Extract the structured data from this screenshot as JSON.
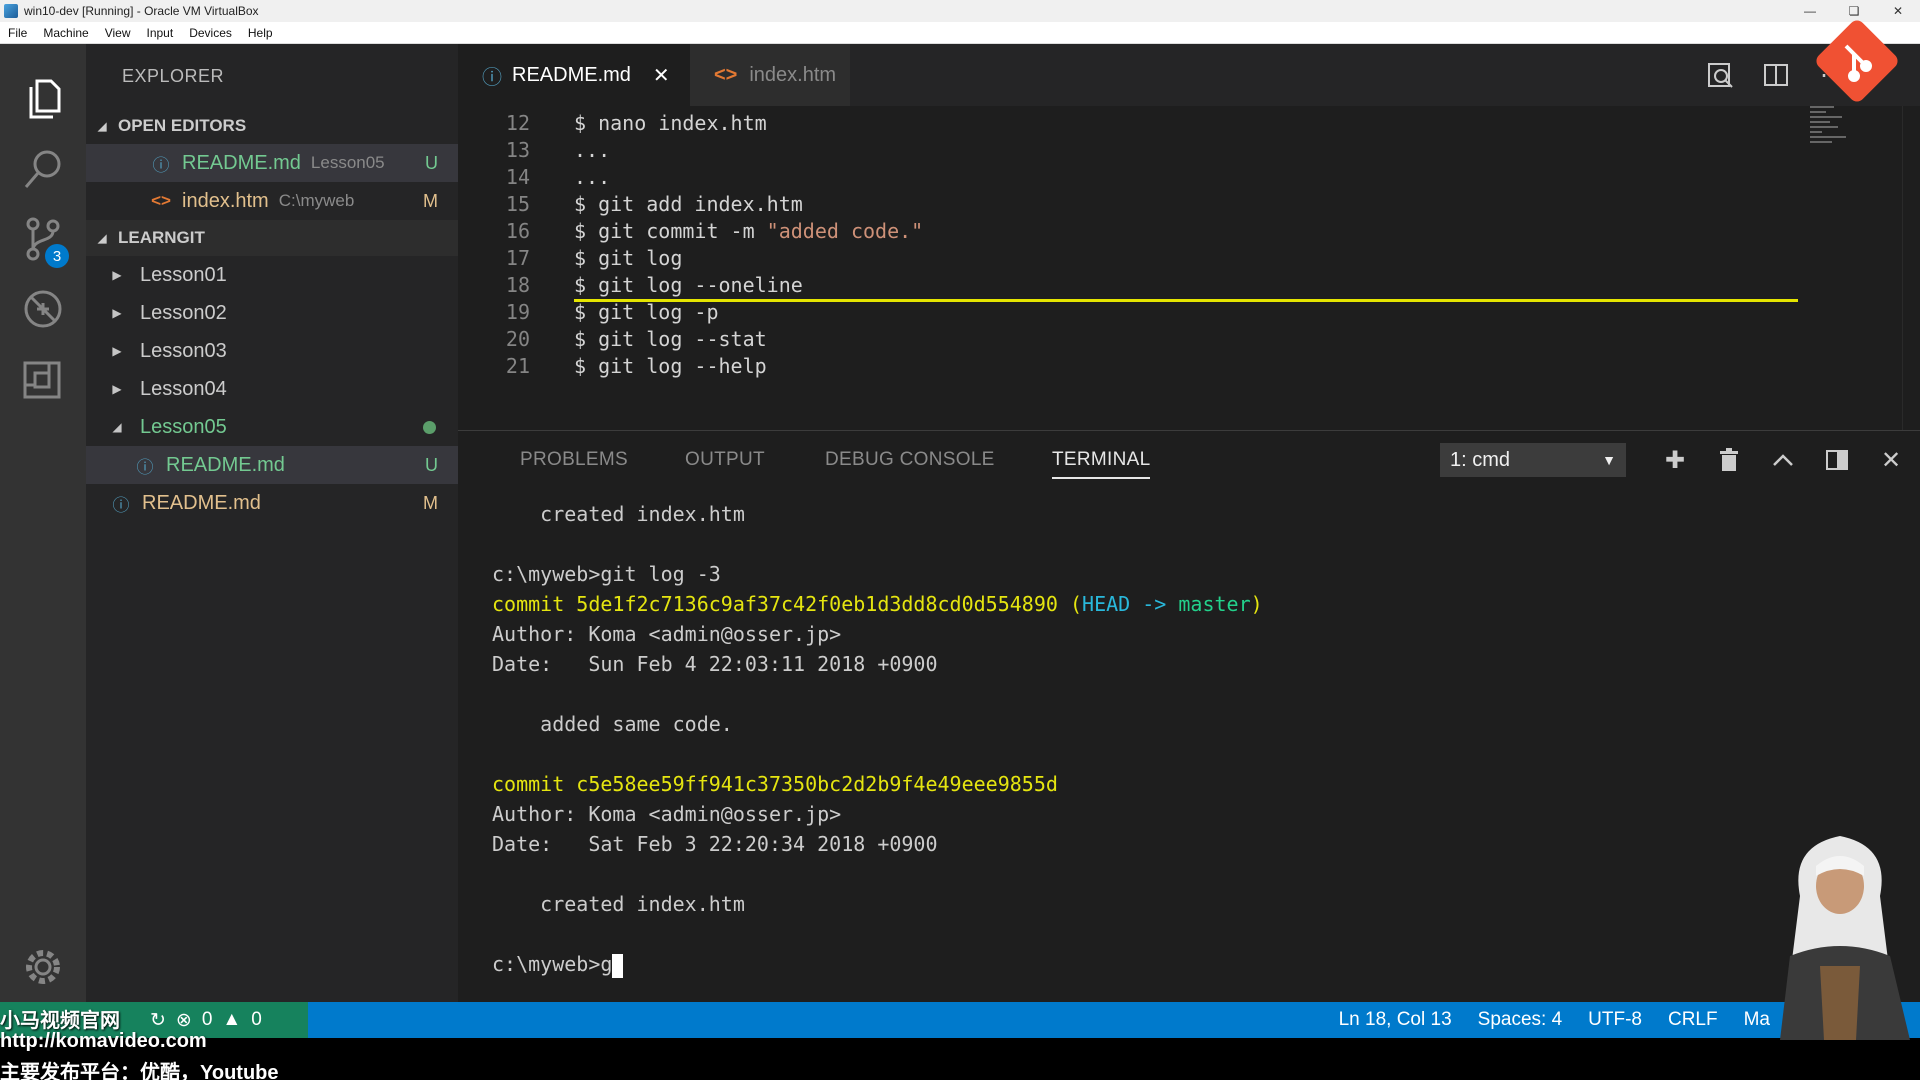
{
  "window": {
    "title": "win10-dev [Running] - Oracle VM VirtualBox",
    "menu": [
      "File",
      "Machine",
      "View",
      "Input",
      "Devices",
      "Help"
    ]
  },
  "activity_bar": {
    "scm_badge": "3"
  },
  "sidebar": {
    "title": "EXPLORER",
    "open_editors": {
      "header": "OPEN EDITORS",
      "items": [
        {
          "name": "README.md",
          "desc": "Lesson05",
          "status": "U"
        },
        {
          "name": "index.htm",
          "desc": "C:\\myweb",
          "status": "M"
        }
      ]
    },
    "workspace": {
      "header": "LEARNGIT",
      "folders": [
        "Lesson01",
        "Lesson02",
        "Lesson03",
        "Lesson04",
        "Lesson05"
      ],
      "child_file": {
        "name": "README.md",
        "status": "U"
      },
      "root_file": {
        "name": "README.md",
        "status": "M"
      }
    }
  },
  "tabs": [
    {
      "label": "README.md",
      "close": "✕"
    },
    {
      "label": "index.htm"
    }
  ],
  "editor": {
    "lines": [
      {
        "num": "12",
        "text": "$ nano index.htm"
      },
      {
        "num": "13",
        "text": "..."
      },
      {
        "num": "14",
        "text": "..."
      },
      {
        "num": "15",
        "text": "$ git add index.htm"
      },
      {
        "num": "16",
        "prefix": "$ git commit -m ",
        "string": "\"added code.\""
      },
      {
        "num": "17",
        "text": "$ git log"
      },
      {
        "num": "18",
        "text": "$ git log --oneline"
      },
      {
        "num": "19",
        "text": "$ git log -p"
      },
      {
        "num": "20",
        "text": "$ git log --stat"
      },
      {
        "num": "21",
        "text": "$ git log --help"
      }
    ]
  },
  "panel": {
    "tabs": [
      "PROBLEMS",
      "OUTPUT",
      "DEBUG CONSOLE",
      "TERMINAL"
    ],
    "terminal_select": "1: cmd",
    "terminal": {
      "line1": "    created index.htm",
      "line2": "c:\\myweb>git log -3",
      "commit1": {
        "prefix": "commit 5de1f2c7136c9af37c42f0eb1d3dd8cd0d554890",
        "paren_open": " (",
        "head": "HEAD -> ",
        "branch": "master",
        "paren_close": ")"
      },
      "author1": "Author: Koma <admin@osser.jp>",
      "date1": "Date:   Sun Feb 4 22:03:11 2018 +0900",
      "msg1": "    added same code.",
      "commit2": "commit c5e58ee59ff941c37350bc2d2b9f4e49eee9855d",
      "author2": "Author: Koma <admin@osser.jp>",
      "date2": "Date:   Sat Feb 3 22:20:34 2018 +0900",
      "msg2": "    created index.htm",
      "prompt": "c:\\myweb>g"
    }
  },
  "statusbar": {
    "errors": "0",
    "warnings": "0",
    "position": "Ln 18, Col 13",
    "spaces": "Spaces: 4",
    "encoding": "UTF-8",
    "eol": "CRLF",
    "language": "Ma"
  },
  "watermark": {
    "line1": "小马视频官网",
    "line2": "http://komavideo.com",
    "line3": "主要发布平台：优酷，Youtube"
  }
}
